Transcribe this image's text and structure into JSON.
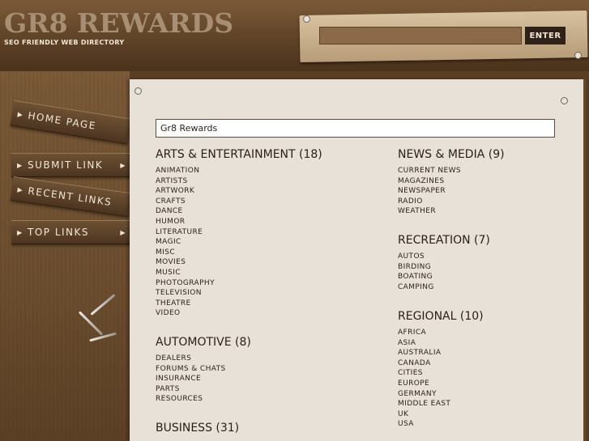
{
  "site": {
    "title": "GR8 REWARDS",
    "tagline": "SEO FRIENDLY WEB DIRECTORY"
  },
  "search": {
    "value": "",
    "button_label": "ENTER"
  },
  "nav": {
    "items": [
      {
        "label": "Home Page"
      },
      {
        "label": "Submit Link"
      },
      {
        "label": "Recent Links"
      },
      {
        "label": "Top Links"
      }
    ]
  },
  "breadcrumb": "Gr8 Rewards",
  "categories_left": [
    {
      "title": "ARTS & ENTERTAINMENT (18)",
      "items": [
        "ANIMATION",
        "ARTISTS",
        "ARTWORK",
        "CRAFTS",
        "DANCE",
        "HUMOR",
        "LITERATURE",
        "MAGIC",
        "MISC",
        "MOVIES",
        "MUSIC",
        "PHOTOGRAPHY",
        "TELEVISION",
        "THEATRE",
        "VIDEO"
      ]
    },
    {
      "title": "AUTOMOTIVE (8)",
      "items": [
        "DEALERS",
        "FORUMS & CHATS",
        "INSURANCE",
        "PARTS",
        "RESOURCES"
      ]
    },
    {
      "title": "BUSINESS (31)",
      "items": []
    }
  ],
  "categories_right": [
    {
      "title": "NEWS & MEDIA (9)",
      "items": [
        "CURRENT NEWS",
        "MAGAZINES",
        "NEWSPAPER",
        "RADIO",
        "WEATHER"
      ]
    },
    {
      "title": "RECREATION (7)",
      "items": [
        "AUTOS",
        "BIRDING",
        "BOATING",
        "CAMPING"
      ]
    },
    {
      "title": "REGIONAL (10)",
      "items": [
        "AFRICA",
        "ASIA",
        "AUSTRALIA",
        "CANADA",
        "CITIES",
        "EUROPE",
        "GERMANY",
        "MIDDLE EAST",
        "UK",
        "USA"
      ]
    }
  ]
}
